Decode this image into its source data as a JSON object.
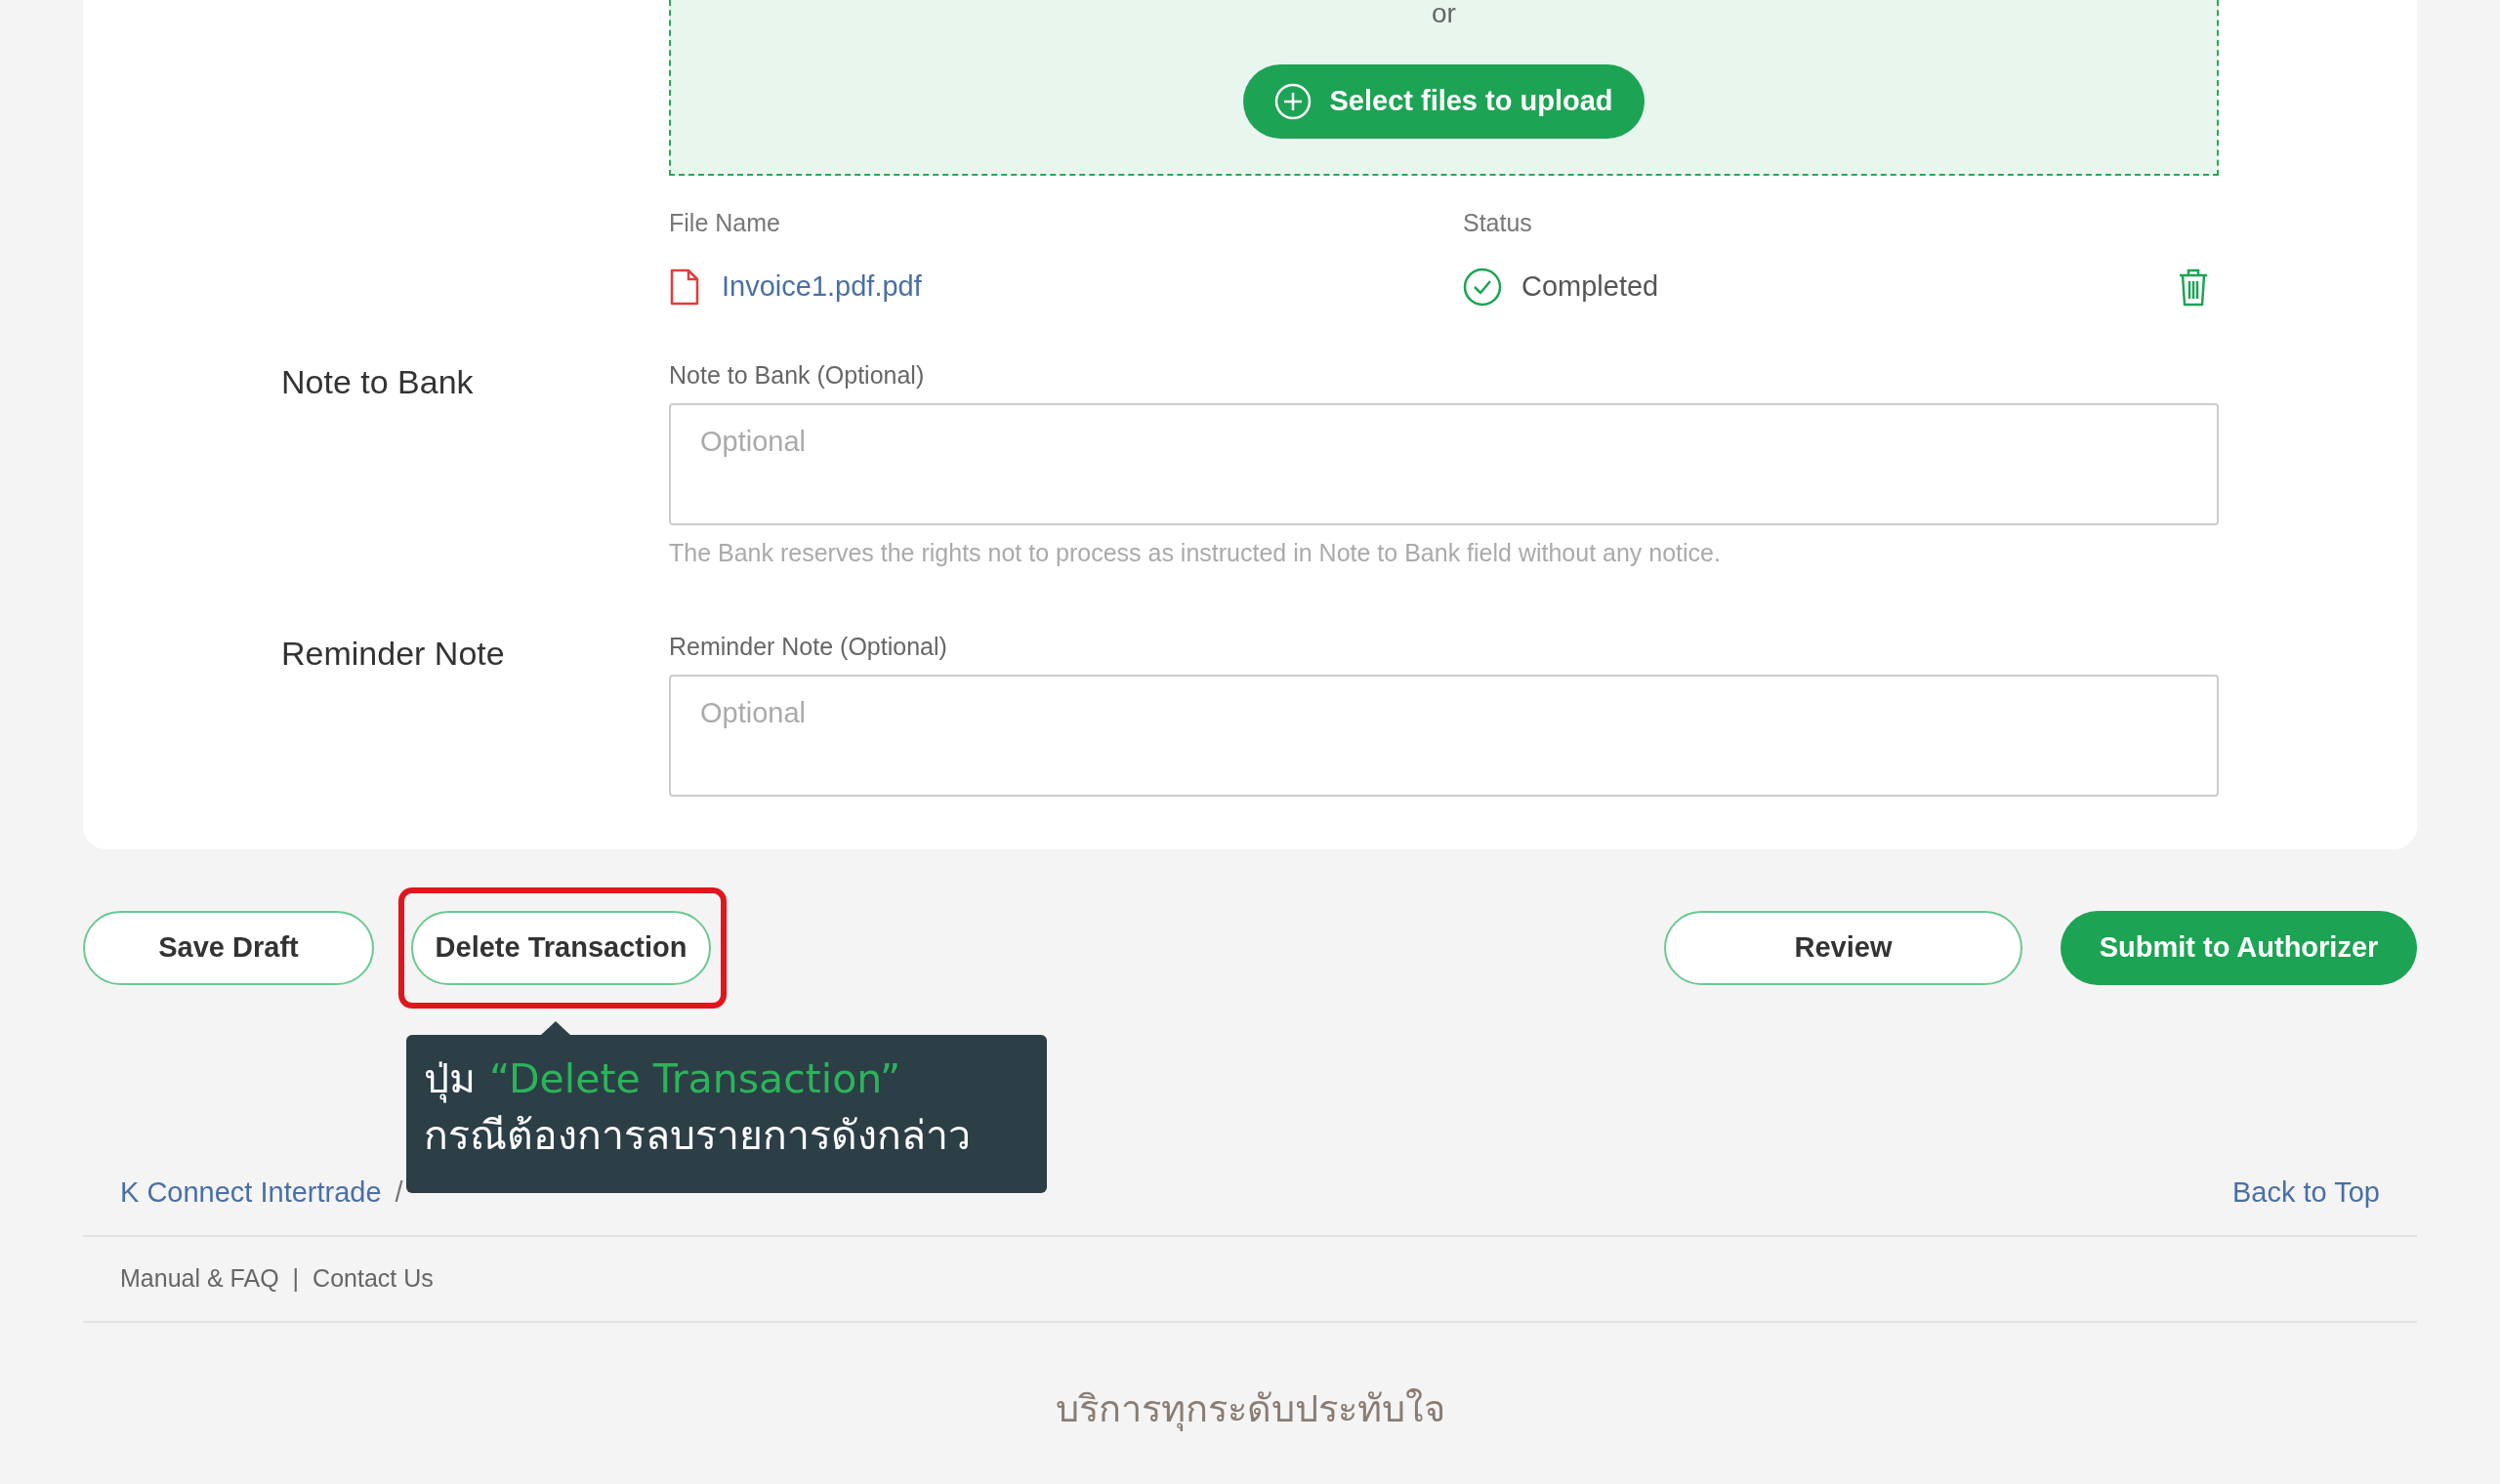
{
  "upload": {
    "or_text": "or",
    "button": "Select files to upload"
  },
  "files": {
    "columns": [
      "File Name",
      "Status"
    ],
    "rows": [
      {
        "name": "Invoice1.pdf.pdf",
        "status": "Completed"
      }
    ]
  },
  "fields": [
    {
      "section": "Note to Bank",
      "label": "Note to Bank (Optional)",
      "placeholder": "Optional",
      "hint": "The Bank reserves the rights not to process as instructed in Note to Bank field without any notice."
    },
    {
      "section": "Reminder Note",
      "label": "Reminder Note (Optional)",
      "placeholder": "Optional"
    }
  ],
  "actions": [
    {
      "label": "Save Draft",
      "kind": "outline",
      "highlighted": false
    },
    {
      "label": "Delete Transaction",
      "kind": "outline",
      "highlighted": true
    },
    {
      "label": "Review",
      "kind": "outline",
      "highlighted": false
    },
    {
      "label": "Submit to Authorizer",
      "kind": "primary",
      "highlighted": false
    }
  ],
  "callout": {
    "prefix": "ปุ่ม",
    "quoted": "“Delete Transaction”",
    "line2": "กรณีต้องการลบรายการดังกล่าว"
  },
  "breadcrumb": [
    {
      "label": "K Connect Intertrade",
      "link": true
    }
  ],
  "breadcrumb_separators": [
    "/"
  ],
  "back_to_top": "Back to Top",
  "footer_links": [
    "Manual & FAQ",
    "Contact Us"
  ],
  "footer_separators": [
    "|"
  ],
  "tagline": "บริการทุกระดับประทับใจ"
}
